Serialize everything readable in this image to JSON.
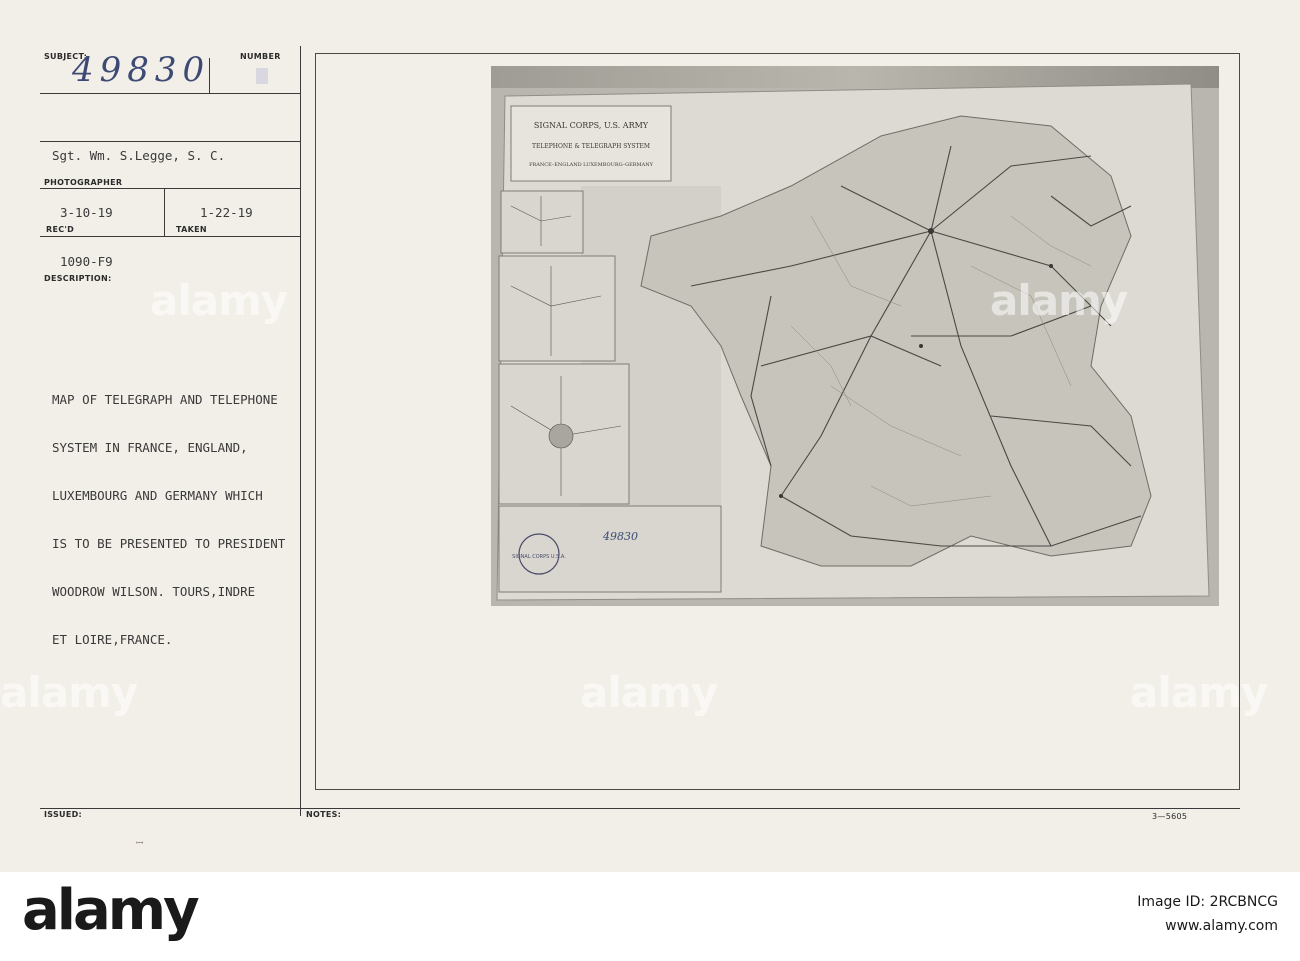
{
  "record": {
    "subject_label": "SUBJECT:",
    "number_label": "NUMBER",
    "subject_number": "49830",
    "photographer_name": "Sgt. Wm. S.Legge, S. C.",
    "photographer_label": "PHOTOGRAPHER",
    "received_date": "3-10-19",
    "received_label": "REC'D",
    "taken_date": "1-22-19",
    "taken_label": "TAKEN",
    "code": "1090-F9",
    "description_label": "DESCRIPTION:",
    "description_lines": [
      "MAP OF TELEGRAPH AND TELEPHONE",
      "SYSTEM IN FRANCE, ENGLAND,",
      "LUXEMBOURG AND GERMANY WHICH",
      "IS TO BE PRESENTED TO PRESIDENT",
      "WOODROW WILSON. TOURS,INDRE",
      "ET LOIRE,FRANCE."
    ],
    "issued_label": "ISSUED:",
    "notes_label": "NOTES:",
    "form_number": "3—5605"
  },
  "map": {
    "title_lines": [
      "SIGNAL CORPS, U.S. ARMY",
      "TELEPHONE & TELEGRAPH SYSTEM",
      "FRANCE–ENGLAND LUXEMBOURG–GERMANY"
    ],
    "stamp_text": "SIGNAL CORPS U.S.A.",
    "stamp_number": "49830"
  },
  "watermarks": [
    "alamy",
    "alamy",
    "alamy",
    "alamy",
    "alamy"
  ],
  "footer": {
    "logo": "alamy",
    "image_id_label": "Image ID: 2RCBNCG",
    "site": "www.alamy.com"
  }
}
